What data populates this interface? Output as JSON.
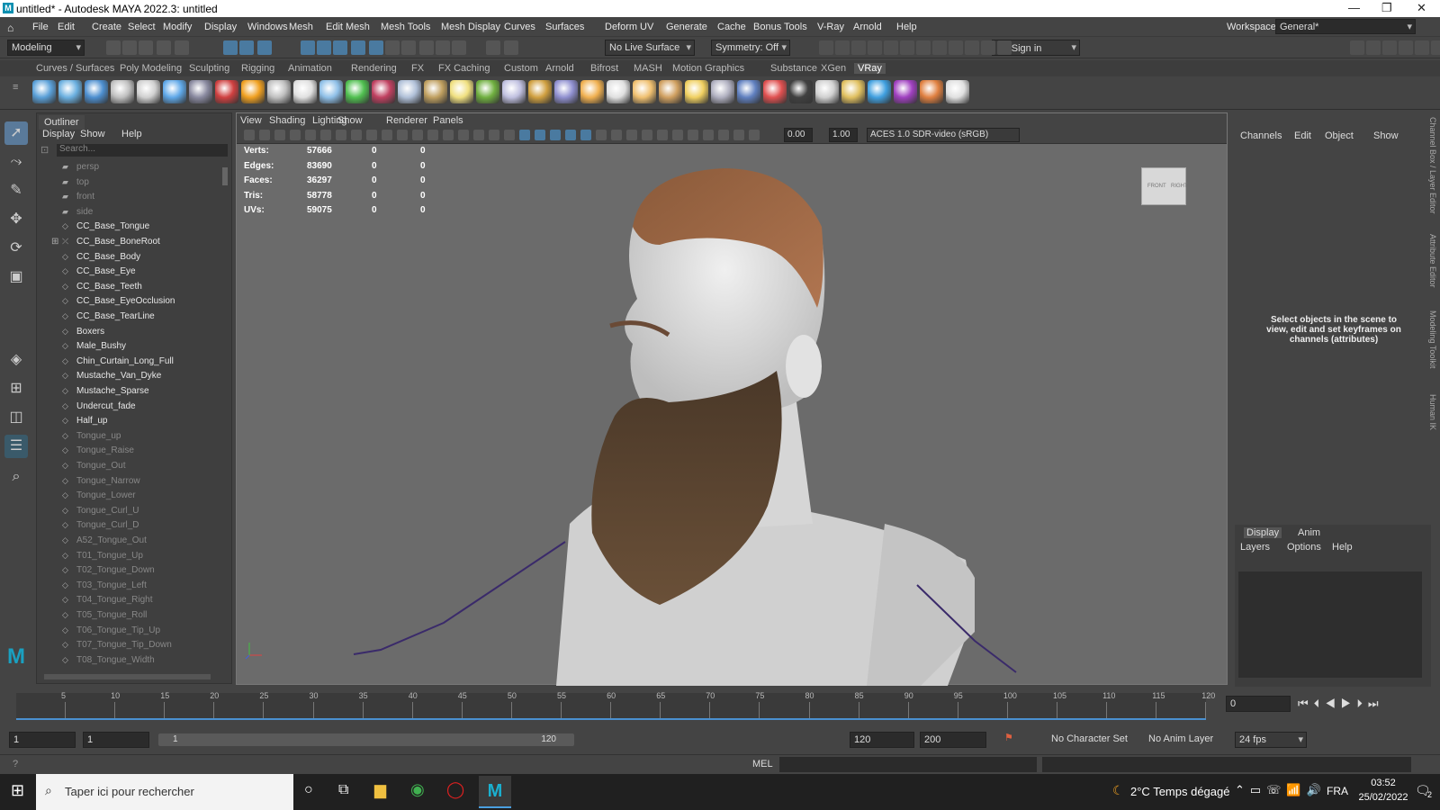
{
  "window": {
    "title": "untitled* - Autodesk MAYA 2022.3: untitled",
    "minimize": "—",
    "maximize": "❐",
    "close": "✕"
  },
  "menubar": {
    "items": [
      "File",
      "Edit",
      "Create",
      "Select",
      "Modify",
      "Display",
      "Windows",
      "Mesh",
      "Edit Mesh",
      "Mesh Tools",
      "Mesh Display",
      "Curves",
      "Surfaces",
      "Deform",
      "UV",
      "Generate",
      "Cache",
      "Bonus Tools",
      "V-Ray",
      "Arnold",
      "Help"
    ],
    "workspace_label": "Workspace:",
    "workspace_value": "General*"
  },
  "statusline": {
    "mode": "Modeling",
    "live_surface": "No Live Surface",
    "symmetry": "Symmetry: Off",
    "signin": "Sign in"
  },
  "shelf": {
    "tabs": [
      "Curves / Surfaces",
      "Poly Modeling",
      "Sculpting",
      "Rigging",
      "Animation",
      "Rendering",
      "FX",
      "FX Caching",
      "Custom",
      "Arnold",
      "Bifrost",
      "MASH",
      "Motion Graphics",
      "Substance",
      "XGen",
      "VRay"
    ],
    "active_tab": "VRay",
    "icon_colors": [
      "#5aa0d8",
      "#6bb0e0",
      "#4d8fd0",
      "#c0c0c0",
      "#d0d0d0",
      "#5fa8e8",
      "#8a8aa0",
      "#d04040",
      "#f0a020",
      "#c0c0c0",
      "#e0e0e0",
      "#8fc0e8",
      "#50c050",
      "#c04060",
      "#b0c0d8",
      "#c0a060",
      "#f0e080",
      "#70b040",
      "#c0c0e0",
      "#d0a040",
      "#9090d0",
      "#f0b050",
      "#e0e0e0",
      "#f0c070",
      "#d0a060",
      "#f0d060",
      "#b0b0c0",
      "#6080c0",
      "#e05050",
      "#404040",
      "#d0d0d0",
      "#e0c060",
      "#40a0e0",
      "#a040c0",
      "#e08040",
      "#e0e0e0"
    ]
  },
  "outliner": {
    "title": "Outliner",
    "menu": [
      "Display",
      "Show",
      "Help"
    ],
    "search_placeholder": "Search...",
    "items": [
      {
        "label": "persp",
        "type": "camera",
        "dim": true
      },
      {
        "label": "top",
        "type": "camera",
        "dim": true
      },
      {
        "label": "front",
        "type": "camera",
        "dim": true
      },
      {
        "label": "side",
        "type": "camera",
        "dim": true
      },
      {
        "label": "CC_Base_Tongue",
        "type": "mesh",
        "dim": false
      },
      {
        "label": "CC_Base_BoneRoot",
        "type": "joint",
        "dim": false,
        "expand": true
      },
      {
        "label": "CC_Base_Body",
        "type": "mesh",
        "dim": false
      },
      {
        "label": "CC_Base_Eye",
        "type": "mesh",
        "dim": false
      },
      {
        "label": "CC_Base_Teeth",
        "type": "mesh",
        "dim": false
      },
      {
        "label": "CC_Base_EyeOcclusion",
        "type": "mesh",
        "dim": false
      },
      {
        "label": "CC_Base_TearLine",
        "type": "mesh",
        "dim": false
      },
      {
        "label": "Boxers",
        "type": "mesh",
        "dim": false
      },
      {
        "label": "Male_Bushy",
        "type": "mesh",
        "dim": false
      },
      {
        "label": "Chin_Curtain_Long_Full",
        "type": "mesh",
        "dim": false
      },
      {
        "label": "Mustache_Van_Dyke",
        "type": "mesh",
        "dim": false
      },
      {
        "label": "Mustache_Sparse",
        "type": "mesh",
        "dim": false
      },
      {
        "label": "Undercut_fade",
        "type": "mesh",
        "dim": false
      },
      {
        "label": "Half_up",
        "type": "mesh",
        "dim": false
      },
      {
        "label": "Tongue_up",
        "type": "mesh",
        "dim": true
      },
      {
        "label": "Tongue_Raise",
        "type": "mesh",
        "dim": true
      },
      {
        "label": "Tongue_Out",
        "type": "mesh",
        "dim": true
      },
      {
        "label": "Tongue_Narrow",
        "type": "mesh",
        "dim": true
      },
      {
        "label": "Tongue_Lower",
        "type": "mesh",
        "dim": true
      },
      {
        "label": "Tongue_Curl_U",
        "type": "mesh",
        "dim": true
      },
      {
        "label": "Tongue_Curl_D",
        "type": "mesh",
        "dim": true
      },
      {
        "label": "A52_Tongue_Out",
        "type": "mesh",
        "dim": true
      },
      {
        "label": "T01_Tongue_Up",
        "type": "mesh",
        "dim": true
      },
      {
        "label": "T02_Tongue_Down",
        "type": "mesh",
        "dim": true
      },
      {
        "label": "T03_Tongue_Left",
        "type": "mesh",
        "dim": true
      },
      {
        "label": "T04_Tongue_Right",
        "type": "mesh",
        "dim": true
      },
      {
        "label": "T05_Tongue_Roll",
        "type": "mesh",
        "dim": true
      },
      {
        "label": "T06_Tongue_Tip_Up",
        "type": "mesh",
        "dim": true
      },
      {
        "label": "T07_Tongue_Tip_Down",
        "type": "mesh",
        "dim": true
      },
      {
        "label": "T08_Tongue_Width",
        "type": "mesh",
        "dim": true
      }
    ]
  },
  "viewport": {
    "menu": [
      "View",
      "Shading",
      "Lighting",
      "Show",
      "Renderer",
      "Panels"
    ],
    "exposure": "0.00",
    "gamma": "1.00",
    "colorspace": "ACES 1.0 SDR-video (sRGB)",
    "hud": [
      {
        "label": "Verts:",
        "v1": "57666",
        "v2": "0",
        "v3": "0"
      },
      {
        "label": "Edges:",
        "v1": "83690",
        "v2": "0",
        "v3": "0"
      },
      {
        "label": "Faces:",
        "v1": "36297",
        "v2": "0",
        "v3": "0"
      },
      {
        "label": "Tris:",
        "v1": "58778",
        "v2": "0",
        "v3": "0"
      },
      {
        "label": "UVs:",
        "v1": "59075",
        "v2": "0",
        "v3": "0"
      }
    ],
    "viewcube_front": "FRONT",
    "viewcube_right": "RIGHT"
  },
  "channelbox": {
    "menu": [
      "Channels",
      "Edit",
      "Object",
      "Show"
    ],
    "message": "Select objects in the scene to view, edit and set keyframes on channels (attributes)",
    "layer_tabs": [
      "Display",
      "Anim"
    ],
    "layer_menu": [
      "Layers",
      "Options",
      "Help"
    ],
    "side_tabs": [
      "Channel Box / Layer Editor",
      "Attribute Editor",
      "Modeling Toolkit",
      "Human IK"
    ]
  },
  "timeline": {
    "ticks": [
      "5",
      "10",
      "15",
      "20",
      "25",
      "30",
      "35",
      "40",
      "45",
      "50",
      "55",
      "60",
      "65",
      "70",
      "75",
      "80",
      "85",
      "90",
      "95",
      "100",
      "105",
      "110",
      "115",
      "120"
    ],
    "current_frame": "0"
  },
  "range": {
    "start": "1",
    "start2": "1",
    "slider_start": "1",
    "slider_end": "120",
    "end": "120",
    "end2": "200",
    "character_set": "No Character Set",
    "anim_layer": "No Anim Layer",
    "fps": "24 fps"
  },
  "cmdline": {
    "lang": "MEL"
  },
  "taskbar": {
    "search": "Taper ici pour rechercher",
    "weather": "2°C  Temps dégagé",
    "lang": "FRA",
    "time": "03:52",
    "date": "25/02/2022",
    "notif_count": "2"
  }
}
